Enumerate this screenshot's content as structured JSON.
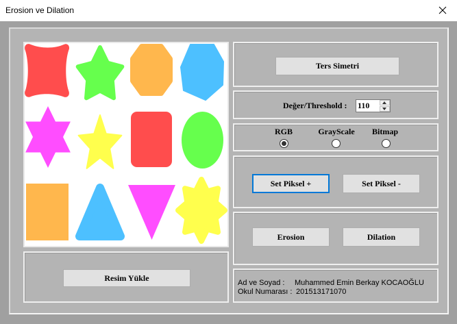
{
  "window": {
    "title": "Erosion ve Dilation"
  },
  "icons": {
    "close": "close-icon",
    "spin_up": "chevron-up-icon",
    "spin_down": "chevron-down-icon"
  },
  "colors": {
    "titlebar": "#ffffff",
    "form": "#a0a0a0",
    "panel": "#b4b4b4",
    "image_background": "#ffffff",
    "button": "#e1e1e1",
    "button_border": "#adadad",
    "focus": "#0078d7"
  },
  "image": {
    "fills": [
      "#ff4d4d",
      "#66ff4d",
      "#ffb74d",
      "#4dc0ff",
      "#ff4dff",
      "#ffff4d",
      "#ff4d4d",
      "#66ff4d",
      "#ffb74d",
      "#4dc0ff",
      "#ff4dff",
      "#ffff4d"
    ]
  },
  "load": {
    "label": "Resim Yükle"
  },
  "mirror": {
    "label": "Ters Simetri"
  },
  "threshold": {
    "label": "Değer/Threshold :",
    "value": "110"
  },
  "mode": {
    "options": [
      {
        "label": "RGB",
        "checked": true
      },
      {
        "label": "GrayScale",
        "checked": false
      },
      {
        "label": "Bitmap",
        "checked": false
      }
    ]
  },
  "pixel": {
    "plus_label": "Set Piksel +",
    "minus_label": "Set Piksel -",
    "plus_focused": true
  },
  "morphology": {
    "erosion_label": "Erosion",
    "dilation_label": "Dilation"
  },
  "info": {
    "name_label": "Ad ve Soyad :",
    "name_value": "Muhammed Emin Berkay KOCAOĞLU",
    "number_label": "Okul Numarası :",
    "number_value": "201513171070"
  }
}
